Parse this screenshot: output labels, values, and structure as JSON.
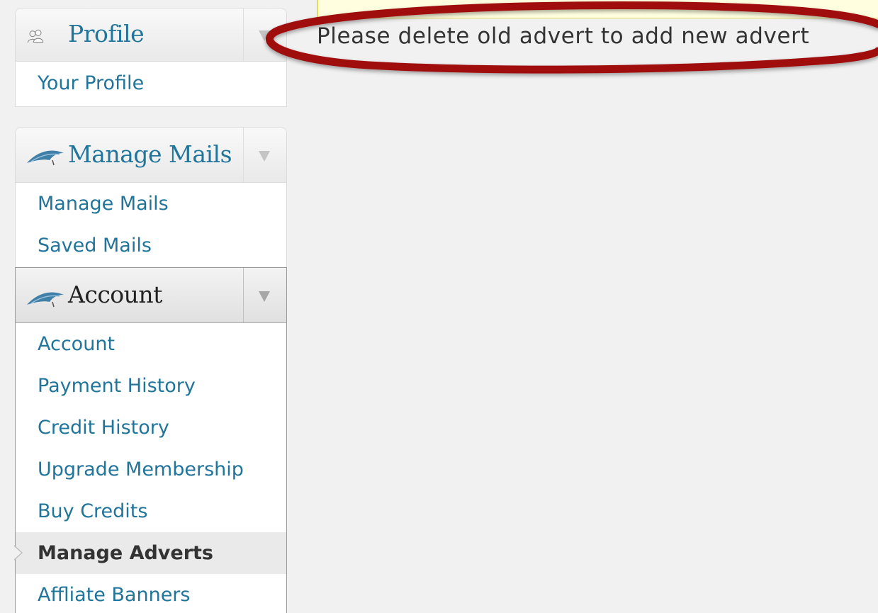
{
  "sidebar": {
    "profile": {
      "title": "Profile",
      "items": [
        {
          "label": "Your Profile"
        }
      ]
    },
    "manage_mails": {
      "title": "Manage Mails",
      "items": [
        {
          "label": "Manage Mails"
        },
        {
          "label": "Saved Mails"
        }
      ]
    },
    "account": {
      "title": "Account",
      "items": [
        {
          "label": "Account"
        },
        {
          "label": "Payment History"
        },
        {
          "label": "Credit History"
        },
        {
          "label": "Upgrade Membership"
        },
        {
          "label": "Buy Credits"
        },
        {
          "label": "Manage Adverts",
          "current": true
        },
        {
          "label": "Affliate Banners"
        }
      ]
    }
  },
  "main": {
    "message": "Please delete old advert to add new advert"
  },
  "colors": {
    "link": "#21759b",
    "highlight_ellipse": "#a01010",
    "notice_background": "#ffffe0"
  },
  "icons": {
    "profile": "users-icon",
    "manage_mails": "feather-bird-icon",
    "account": "feather-bird-icon",
    "toggle": "triangle-down-icon"
  }
}
